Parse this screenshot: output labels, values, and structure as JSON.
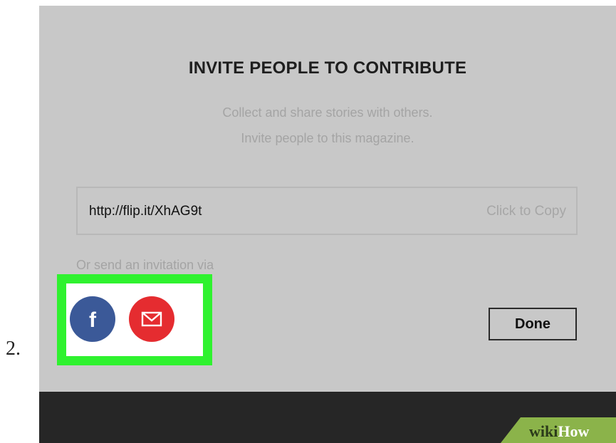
{
  "step_number": "2.",
  "dialog": {
    "title": "INVITE PEOPLE TO CONTRIBUTE",
    "subtitle_line1": "Collect and share stories with others.",
    "subtitle_line2": "Invite people to this magazine.",
    "link_url": "http://flip.it/XhAG9t",
    "copy_label": "Click to Copy",
    "or_send_label": "Or send an invitation via",
    "share_options": [
      {
        "icon": "facebook-icon",
        "glyph": "f",
        "color": "#3b5998"
      },
      {
        "icon": "mail-icon",
        "color": "#e52c30"
      }
    ],
    "done_label": "Done"
  },
  "watermark": {
    "part1": "wiki",
    "part2": "How"
  },
  "colors": {
    "highlight": "#2ff22f",
    "backdrop": "#c8c8c8",
    "bottom_bar": "#262626",
    "badge": "#8bb34a"
  }
}
